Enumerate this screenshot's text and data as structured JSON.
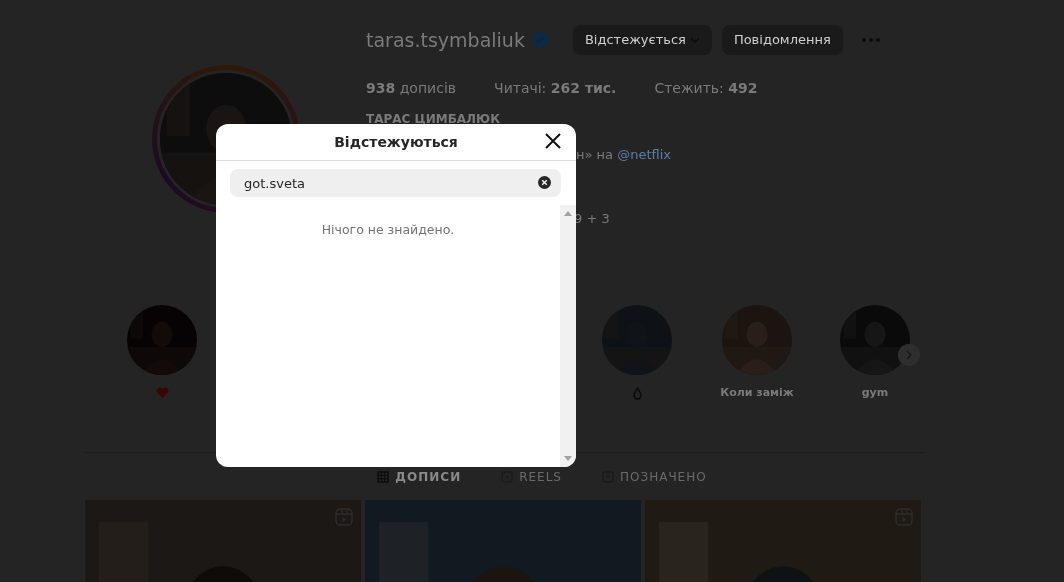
{
  "profile": {
    "username": "taras.tsymbaliuk",
    "verified": true,
    "follow_button": "Відстежується",
    "message_button": "Повідомлення",
    "stats": [
      "**938** дописів",
      "Читачі: **262 тис.**",
      "Стежить: **492**"
    ],
    "name": "ТАРАС ЦИМБАЛЮК",
    "bio_fragments": [
      {
        "text": "н» на",
        "link": "@netflix"
      },
      {
        "text": "9 + 3"
      }
    ]
  },
  "highlights": [
    {
      "kind": "heart"
    },
    {
      "kind": "drop"
    },
    {
      "kind": "text",
      "label": "Коли заміж"
    },
    {
      "kind": "text",
      "label": "gym"
    }
  ],
  "tabs": [
    {
      "kind": "grid",
      "label": "ДОПИСИ",
      "selected": true
    },
    {
      "kind": "reels",
      "label": "REELS",
      "selected": false
    },
    {
      "kind": "tag",
      "label": "ПОЗНАЧЕНО",
      "selected": false
    }
  ],
  "posts": [
    {
      "reel": true
    },
    {
      "reel": false
    },
    {
      "reel": true
    }
  ],
  "modal": {
    "title": "Відстежуються",
    "search": {
      "value": "got.sveta"
    },
    "empty_message": "Нічого не знайдено."
  }
}
